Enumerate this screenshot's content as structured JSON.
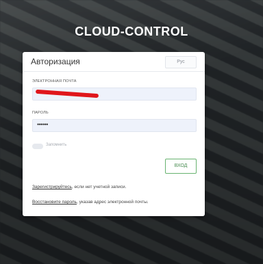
{
  "brand": {
    "name": "CLOUD-CONTROL"
  },
  "auth": {
    "title": "Авторизация",
    "lang_label": "Рус",
    "email_label": "ЭЛЕКТРОННАЯ ПОЧТА",
    "password_label": "ПАРОЛЬ",
    "password_value": "••••••",
    "remember_label": "Запомнить",
    "login_button": "ВХОД",
    "register_link": "Зарегистрируйтесь",
    "register_text": ", если нет учетной записи.",
    "restore_link": "Восстановите пароль",
    "restore_text": ", указав адрес электронной почты."
  },
  "colors": {
    "redaction": "#e0161b",
    "accent": "#67b26f",
    "field_bg": "#eef2fb"
  }
}
